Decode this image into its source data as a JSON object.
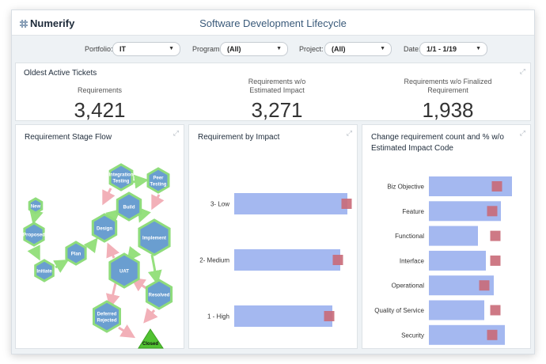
{
  "header": {
    "logo_text": "Numerify",
    "title": "Software Development Lifecycle"
  },
  "filters": [
    {
      "label": "Portfolio:",
      "value": "IT"
    },
    {
      "label": "Program:",
      "value": "(All)"
    },
    {
      "label": "Project:",
      "value": "(All)"
    },
    {
      "label": "Date:",
      "value": "1/1 - 1/19"
    }
  ],
  "tickets": {
    "title": "Oldest Active Tickets",
    "kpis": [
      {
        "label": "Requirements",
        "value": "3,421"
      },
      {
        "label": "Requirements w/o Estimated Impact",
        "value": "3,271"
      },
      {
        "label": "Requirements w/o Finalized Requirement",
        "value": "1,938"
      }
    ]
  },
  "stage_flow": {
    "title": "Requirement Stage Flow",
    "nodes": [
      "New",
      "Proposed",
      "Initiate",
      "Plan",
      "Design",
      "Integration Testing",
      "Peer Testing",
      "Build",
      "Implement",
      "UAT",
      "Resolved",
      "Deferred Rejected",
      "Closed"
    ]
  },
  "impact": {
    "title": "Requirement by Impact",
    "categories": [
      "3- Low",
      "2- Medium",
      "1 - High"
    ]
  },
  "change": {
    "title": "Change requirement count and % w/o Estimated Impact Code",
    "categories": [
      "Biz Objective",
      "Feature",
      "Functional",
      "Interface",
      "Operational",
      "Quality of Service",
      "Security"
    ]
  },
  "colors": {
    "bar": "#a4b8f0",
    "marker": "#c96a78",
    "node_fill": "#6a9ed0",
    "node_stroke": "#8fdc7c",
    "arrow_pink": "#f2b0b8",
    "arrow_green": "#96e07e",
    "closed": "#52c232"
  },
  "chart_data": [
    {
      "type": "bar",
      "title": "Requirement by Impact",
      "categories": [
        "3- Low",
        "2- Medium",
        "1 - High"
      ],
      "series": [
        {
          "values": [
            143,
            134,
            124
          ]
        },
        {
          "values": [
            142,
            131,
            120
          ]
        }
      ]
    },
    {
      "type": "bar",
      "title": "Change requirement count and % w/o Estimated Impact Code",
      "categories": [
        "Biz Objective",
        "Feature",
        "Functional",
        "Interface",
        "Operational",
        "Quality of Service",
        "Security"
      ],
      "series": [
        {
          "values": [
            105,
            91,
            62,
            72,
            82,
            70,
            96
          ]
        },
        {
          "values": [
            86,
            80,
            84,
            84,
            70,
            84,
            80
          ]
        }
      ]
    }
  ]
}
